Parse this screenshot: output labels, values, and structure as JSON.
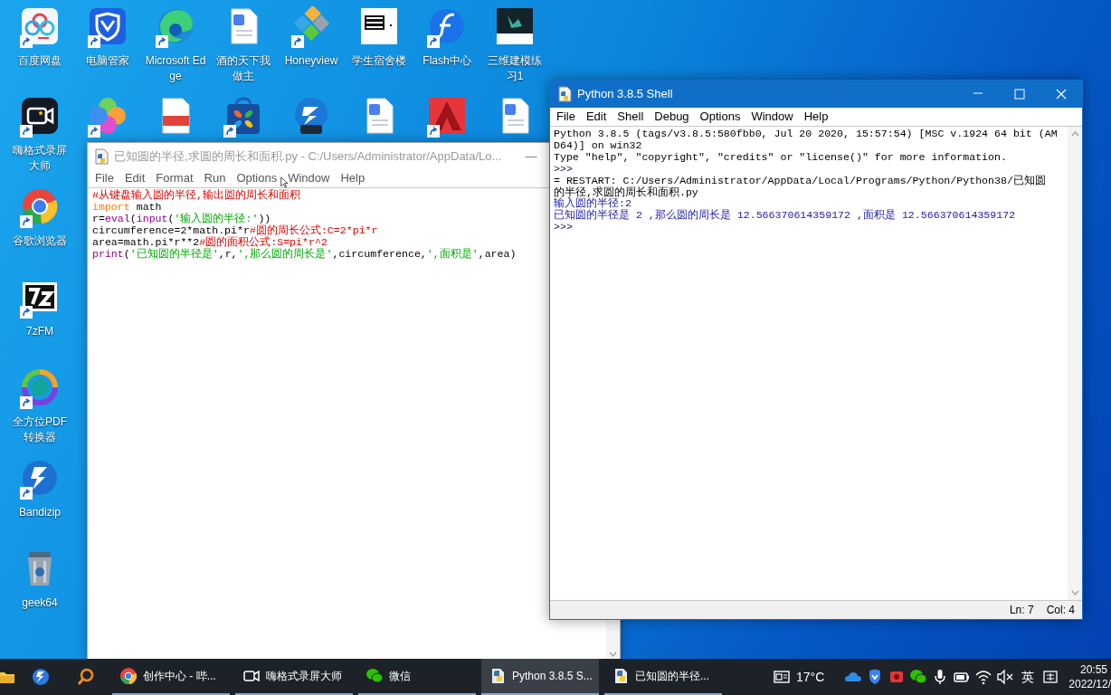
{
  "desktop": {
    "top_row": [
      {
        "label": "百度网盘",
        "kind": "cloud",
        "shortcut": true
      },
      {
        "label": "电脑管家",
        "kind": "shield",
        "shortcut": true
      },
      {
        "label": "Microsoft Edge",
        "kind": "edge",
        "shortcut": true
      },
      {
        "label": "酒的天下我做主",
        "kind": "doc",
        "shortcut": false
      },
      {
        "label": "Honeyview",
        "kind": "diamonds",
        "shortcut": true
      },
      {
        "label": "学生宿舍楼",
        "kind": "barcode",
        "shortcut": false
      },
      {
        "label": "Flash中心",
        "kind": "flash",
        "shortcut": true
      },
      {
        "label": "三维建模练习1",
        "kind": "model",
        "shortcut": false
      }
    ],
    "second_row": [
      {
        "kind": "petals",
        "shortcut": true
      },
      {
        "kind": "pdf",
        "shortcut": false
      },
      {
        "kind": "bag",
        "shortcut": true
      },
      {
        "kind": "zip",
        "shortcut": false
      },
      {
        "kind": "doc",
        "shortcut": false
      },
      {
        "kind": "cad",
        "shortcut": true
      },
      {
        "kind": "doc",
        "shortcut": false
      }
    ],
    "left_column": [
      {
        "label": "嗨格式录屏大师",
        "kind": "camera",
        "shortcut": true
      },
      {
        "label": "谷歌浏览器",
        "kind": "chrome",
        "shortcut": true
      },
      {
        "label": "7zFM",
        "kind": "sevenzip",
        "shortcut": true
      },
      {
        "label": "全方位PDF转换器",
        "kind": "ring",
        "shortcut": true
      },
      {
        "label": "Bandizip",
        "kind": "bolt",
        "shortcut": true
      },
      {
        "label": "geek64",
        "kind": "bin",
        "shortcut": false
      }
    ]
  },
  "editor": {
    "title": "已知圆的半径,求圆的周长和面积.py - C:/Users/Administrator/AppData/Lo...",
    "minimize": "—",
    "menu": [
      "File",
      "Edit",
      "Format",
      "Run",
      "Options",
      "Window",
      "Help"
    ],
    "lines": [
      [
        {
          "kind": "comment",
          "text": "#从键盘输入圆的半径,输出圆的周长和面积"
        }
      ],
      [
        {
          "kind": "keyword",
          "text": "import"
        },
        {
          "kind": "plain",
          "text": " math"
        }
      ],
      [
        {
          "kind": "plain",
          "text": "r="
        },
        {
          "kind": "builtin",
          "text": "eval"
        },
        {
          "kind": "plain",
          "text": "("
        },
        {
          "kind": "builtin",
          "text": "input"
        },
        {
          "kind": "plain",
          "text": "("
        },
        {
          "kind": "string",
          "text": "'输入圆的半径:'"
        },
        {
          "kind": "plain",
          "text": "))"
        }
      ],
      [
        {
          "kind": "plain",
          "text": "circumference=2*math.pi*r"
        },
        {
          "kind": "comment",
          "text": "#圆的周长公式:C=2*pi*r"
        }
      ],
      [
        {
          "kind": "plain",
          "text": "area=math.pi*r**2"
        },
        {
          "kind": "comment",
          "text": "#圆的面积公式:S=pi*r^2"
        }
      ],
      [
        {
          "kind": "builtin",
          "text": "print"
        },
        {
          "kind": "plain",
          "text": "("
        },
        {
          "kind": "string",
          "text": "'已知圆的半径是'"
        },
        {
          "kind": "plain",
          "text": ",r,"
        },
        {
          "kind": "string",
          "text": "',那么圆的周长是'"
        },
        {
          "kind": "plain",
          "text": ",circumference,"
        },
        {
          "kind": "string",
          "text": "',面积是'"
        },
        {
          "kind": "plain",
          "text": ",area)"
        }
      ]
    ]
  },
  "shell": {
    "title": "Python 3.8.5 Shell",
    "menu": [
      "File",
      "Edit",
      "Shell",
      "Debug",
      "Options",
      "Window",
      "Help"
    ],
    "lines": [
      {
        "kind": "output",
        "text": "Python 3.8.5 (tags/v3.8.5:580fbb0, Jul 20 2020, 15:57:54) [MSC v.1924 64 bit (AM"
      },
      {
        "kind": "output",
        "text": "D64)] on win32"
      },
      {
        "kind": "output",
        "text": "Type \"help\", \"copyright\", \"credits\" or \"license()\" for more information."
      },
      {
        "kind": "prompt",
        "text": ">>>"
      },
      {
        "kind": "output",
        "text": "= RESTART: C:/Users/Administrator/AppData/Local/Programs/Python/Python38/已知圆"
      },
      {
        "kind": "output",
        "text": "的半径,求圆的周长和面积.py"
      },
      {
        "kind": "stdout",
        "text": "输入圆的半径:2"
      },
      {
        "kind": "stdout",
        "text": "已知圆的半径是 2 ,那么圆的周长是 12.566370614359172 ,面积是 12.566370614359172"
      },
      {
        "kind": "prompt",
        "text": ">>>"
      }
    ],
    "status": {
      "line": "Ln: 7",
      "col": "Col: 4"
    }
  },
  "taskbar": {
    "pinned": [
      {
        "kind": "folder"
      },
      {
        "kind": "bolt"
      },
      {
        "kind": "search"
      }
    ],
    "apps": [
      {
        "label": "创作中心 - 哔...",
        "kind": "chrome",
        "selected": false
      },
      {
        "label": "嗨格式录屏大师",
        "kind": "camera",
        "selected": false
      },
      {
        "label": "微信",
        "kind": "wechat",
        "selected": false
      },
      {
        "label": "Python 3.8.5 S...",
        "kind": "python",
        "selected": true
      },
      {
        "label": "已知圆的半径...",
        "kind": "python",
        "selected": false
      }
    ],
    "weather": "17°C",
    "tray": [
      {
        "kind": "cloud"
      },
      {
        "kind": "shield"
      },
      {
        "kind": "record"
      },
      {
        "kind": "wechat"
      },
      {
        "kind": "mic"
      },
      {
        "kind": "battery"
      },
      {
        "kind": "wifi"
      },
      {
        "kind": "mute"
      }
    ],
    "input_language": "英",
    "time": "20:55",
    "date": "2022/12/"
  }
}
